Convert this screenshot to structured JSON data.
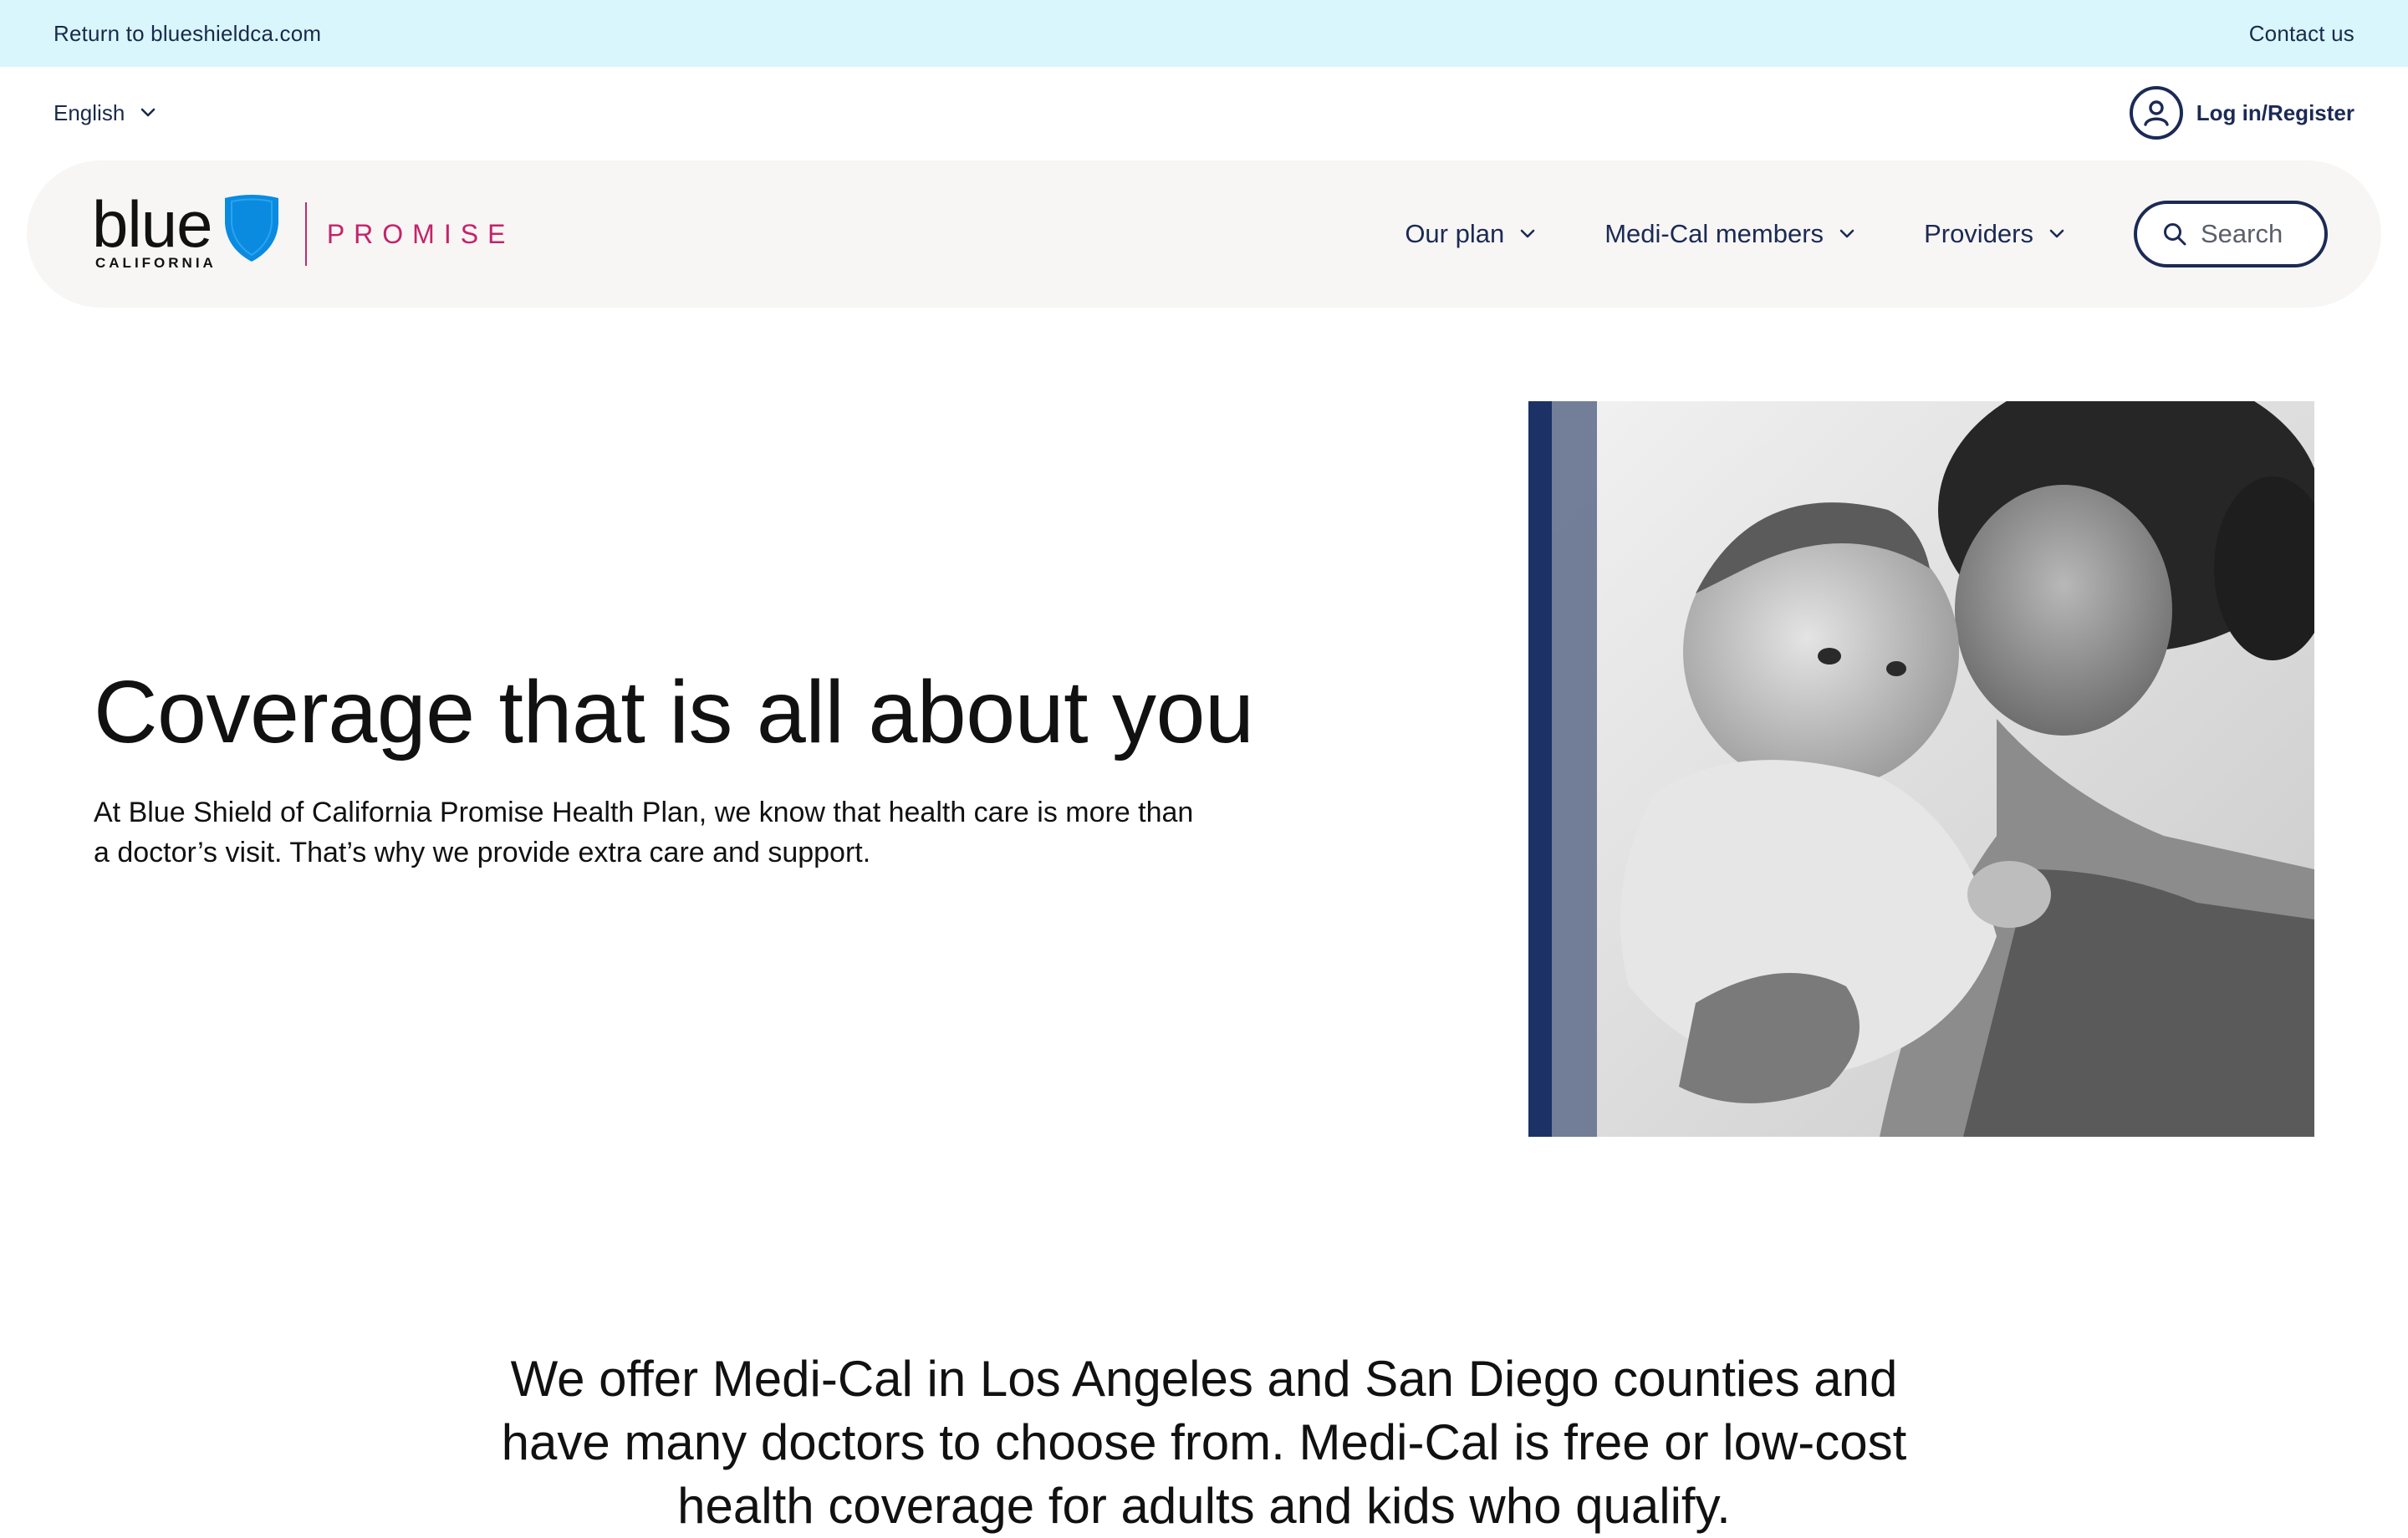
{
  "utility_bar": {
    "return_link": "Return to blueshieldca.com",
    "contact_link": "Contact us"
  },
  "sub_bar": {
    "language": "English",
    "login_label": "Log in/Register"
  },
  "logo": {
    "wordmark": "blue",
    "subtitle": "CALIFORNIA",
    "product": "PROMISE"
  },
  "nav": {
    "items": [
      {
        "label": "Our plan"
      },
      {
        "label": "Medi-Cal members"
      },
      {
        "label": "Providers"
      }
    ],
    "search_label": "Search"
  },
  "hero": {
    "title": "Coverage that is all about you",
    "text": "At Blue Shield of California Promise Health Plan, we know that health care is more than a doctor’s visit. That’s why we provide extra care and support."
  },
  "statement": {
    "text": "We offer Medi-Cal in Los Angeles and San Diego counties and have many doctors to choose from. Medi-Cal is free or low-cost health coverage for adults and kids who qualify."
  },
  "colors": {
    "utility_bar_bg": "#d8f6fc",
    "navy": "#1b2a55",
    "promise_pink": "#c4236b",
    "shield_blue": "#0a8be0",
    "nav_bg": "#f7f6f4"
  }
}
